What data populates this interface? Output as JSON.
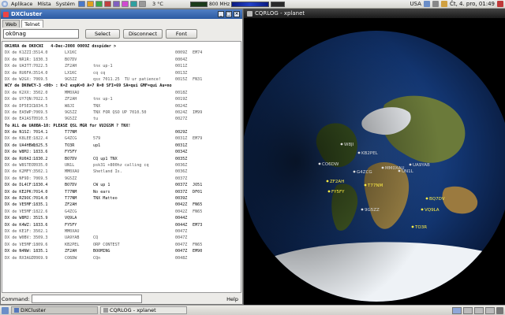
{
  "top_panel": {
    "menus": [
      "Aplikace",
      "Místa",
      "Systém"
    ],
    "weather": "3 °C",
    "cpu": "800 MHz",
    "locale": "USA",
    "clock": "Čt,  4. pro, 01:49"
  },
  "dx_window": {
    "title": "DXCluster",
    "tabs": [
      "Web",
      "Telnet"
    ],
    "callsign_value": "ok0nag",
    "select_label": "Select",
    "disconnect_label": "Disconnect",
    "font_label": "Font",
    "command_label": "Command:",
    "help_label": "Help",
    "log": [
      {
        "type": "msg",
        "text": "OK1HRA de OK0CNI   4-Dec-2008 0009Z dxspider >"
      },
      {
        "type": "spot",
        "cells": [
          "DX de K1ZZI:",
          "3514.0",
          "LX1KC",
          "",
          "0009Z",
          "EM74"
        ]
      },
      {
        "type": "spot",
        "cells": [
          "DX de NR1R:",
          "1830.3",
          "BO7DV",
          "",
          "0004Z",
          ""
        ]
      },
      {
        "type": "spot",
        "cells": [
          "DX de UA3TT:",
          "7022.5",
          "ZF2AH",
          "tnx up-1",
          "0011Z",
          ""
        ]
      },
      {
        "type": "spot",
        "cells": [
          "DX de RU6FA:",
          "3514.0",
          "LX1KC",
          "cq cq",
          "0013Z",
          ""
        ]
      },
      {
        "type": "spot",
        "cells": [
          "DX de W2GX:",
          "7069.5",
          "9G5ZZ",
          "qsx 7011.25  TU ur patience!",
          "0015Z",
          "FN31"
        ]
      },
      {
        "type": "msg",
        "text": "WCY de DK0WCY-3 <00> : K=2 expK=0 A=7 R=0 SFI=69 SA=qui GMF=qui Au=no"
      },
      {
        "type": "spot",
        "cells": [
          "DX de K2XX:",
          "3502.0",
          "MM0XAU",
          "",
          "0018Z",
          ""
        ]
      },
      {
        "type": "spot",
        "cells": [
          "DX de UY7QN:",
          "7022.5",
          "ZF2AH",
          "tnx up-1",
          "0019Z",
          ""
        ]
      },
      {
        "type": "spot",
        "cells": [
          "DX de DF5EIC:",
          "1834.5",
          "W8JI",
          "TNX",
          "0024Z",
          ""
        ]
      },
      {
        "type": "spot",
        "cells": [
          "DX de EA5WP:",
          "7069.5",
          "9G5ZZ",
          "TNX FOR QSO UP 7010.50",
          "0024Z",
          "IM99"
        ]
      },
      {
        "type": "spot",
        "cells": [
          "DX de EA1AST:",
          "7010.5",
          "9G5ZZ",
          "tu",
          "0027Z",
          ""
        ]
      },
      {
        "type": "msg",
        "text": "To ALL de UA0BA-10: PLEASE QSL MGR for VU2GSM ? TNX!"
      },
      {
        "type": "hi",
        "cells": [
          "DX de N1SZ:",
          "7014.1",
          "T77NM",
          "",
          "0029Z",
          ""
        ]
      },
      {
        "type": "spot",
        "cells": [
          "DX de K8LEE:",
          "1822.4",
          "G4ZCG",
          "579",
          "0031Z",
          "EM79"
        ]
      },
      {
        "type": "hi",
        "cells": [
          "DX de UA4HBW:",
          "1825.5",
          "TO3R",
          "up1",
          "0031Z",
          ""
        ]
      },
      {
        "type": "hi",
        "cells": [
          "DX de W8MJ:",
          "1833.6",
          "FY5FY",
          "",
          "0034Z",
          ""
        ]
      },
      {
        "type": "hi",
        "cells": [
          "DX de RU0AI:",
          "1830.2",
          "BO7DV",
          "CQ up1 TNX",
          "0035Z",
          ""
        ]
      },
      {
        "type": "spot",
        "cells": [
          "DX de W8STEO:",
          "7035.0",
          "UN1L",
          "psk31 +800hz calling cq",
          "0036Z",
          ""
        ]
      },
      {
        "type": "spot",
        "cells": [
          "DX de K2MFY:",
          "3502.1",
          "MM0XAU",
          "Shetland Is.",
          "0036Z",
          ""
        ]
      },
      {
        "type": "spot",
        "cells": [
          "DX de NF9D:",
          "7069.5",
          "9G5ZZ",
          "",
          "0037Z",
          ""
        ]
      },
      {
        "type": "hi",
        "cells": [
          "DX de DL4CF:",
          "1830.4",
          "BO7DV",
          "CW up 1",
          "0037Z",
          "JO51"
        ]
      },
      {
        "type": "hi",
        "cells": [
          "DX de KE2PK:",
          "7014.0",
          "T77NM",
          "No ears",
          "0037Z",
          "DF01"
        ]
      },
      {
        "type": "hi",
        "cells": [
          "DX de RZ9OC:",
          "7014.0",
          "T77NM",
          "TNX Matteo",
          "0039Z",
          ""
        ]
      },
      {
        "type": "hi",
        "cells": [
          "DX de VE5MF:",
          "1835.1",
          "ZF2AH",
          "",
          "0042Z",
          "FN65"
        ]
      },
      {
        "type": "spot",
        "cells": [
          "DX de VE5MF:",
          "1822.6",
          "G4ZCG",
          "",
          "0042Z",
          "FN65"
        ]
      },
      {
        "type": "hi",
        "cells": [
          "DX de W8MJ:",
          "3515.9",
          "VQ9LA",
          "",
          "0044Z",
          ""
        ]
      },
      {
        "type": "hi",
        "cells": [
          "DX de K4WZ:",
          "1833.6",
          "FY5FY",
          "",
          "0044Z",
          "EM73"
        ]
      },
      {
        "type": "spot",
        "cells": [
          "DX de KE1F:",
          "3502.1",
          "MM0XAU",
          "",
          "0047Z",
          ""
        ]
      },
      {
        "type": "spot",
        "cells": [
          "DX de W0BV:",
          "3509.3",
          "UA9YAB",
          "CQ",
          "0047Z",
          ""
        ]
      },
      {
        "type": "spot",
        "cells": [
          "DX de VE5MF:",
          "1809.6",
          "KB2PEL",
          "ORP CONTEST",
          "0047Z",
          "FN65"
        ]
      },
      {
        "type": "hi",
        "cells": [
          "DX de N4NW:",
          "1835.1",
          "ZF2AH",
          "BOOMING",
          "0047Z",
          "EM90"
        ]
      },
      {
        "type": "spot",
        "cells": [
          "DX de RX3AGD:",
          "7069.9",
          "CO6DW",
          "CQn",
          "0048Z",
          ""
        ]
      }
    ]
  },
  "xplanet_window": {
    "title": "CQRLOG - xplanet",
    "labels": [
      {
        "text": "W8JI",
        "tone": "grey"
      },
      {
        "text": "KB2PEL",
        "tone": "grey"
      },
      {
        "text": "CO6DW",
        "tone": "grey"
      },
      {
        "text": "ZF2AH",
        "tone": "yellow"
      },
      {
        "text": "FY5FY",
        "tone": "yellow"
      },
      {
        "text": "G4ZCG",
        "tone": "grey"
      },
      {
        "text": "MM0XAU",
        "tone": "grey"
      },
      {
        "text": "UN1L",
        "tone": "grey"
      },
      {
        "text": "UA9YAB",
        "tone": "grey"
      },
      {
        "text": "T77NM",
        "tone": "yellow"
      },
      {
        "text": "BQ7DV",
        "tone": "yellow"
      },
      {
        "text": "VQ9LA",
        "tone": "yellow"
      },
      {
        "text": "9G5ZZ",
        "tone": "grey"
      },
      {
        "text": "TO3R",
        "tone": "yellow"
      }
    ]
  },
  "bottom_panel": {
    "tasks": [
      "DXCluster",
      "CQRLOG - xplanet"
    ]
  }
}
